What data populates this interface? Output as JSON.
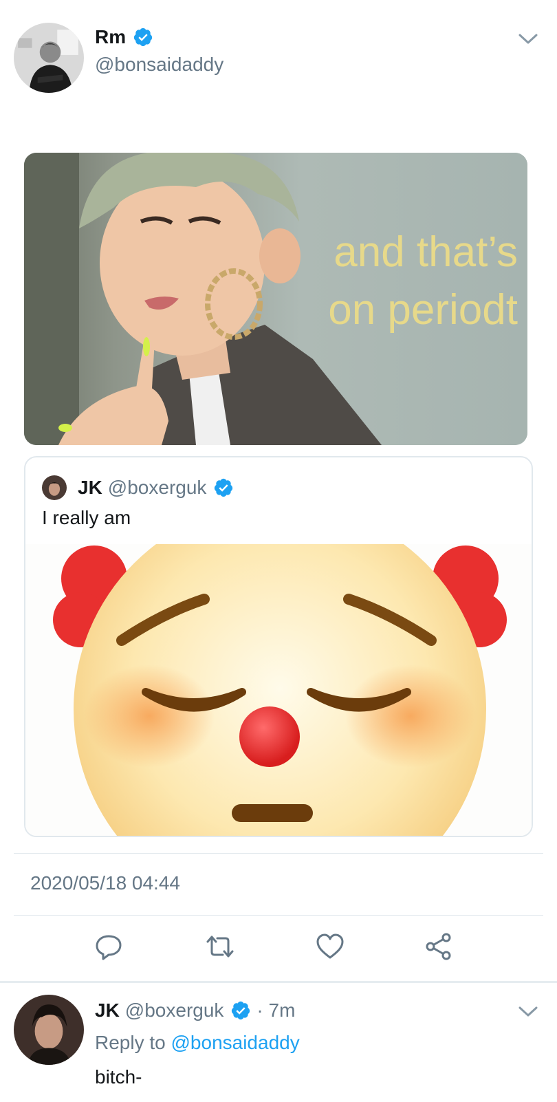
{
  "tweet": {
    "author_name": "Rm",
    "author_handle": "@bonsaidaddy",
    "verified": true,
    "media_caption": "and that’s on periodt",
    "timestamp": "2020/05/18 04:44"
  },
  "quote": {
    "author_name": "JK",
    "author_handle": "@boxerguk",
    "verified": true,
    "text": "I really am"
  },
  "actions": [
    {
      "icon": "reply-icon"
    },
    {
      "icon": "retweet-icon"
    },
    {
      "icon": "like-icon"
    },
    {
      "icon": "share-icon"
    }
  ],
  "reply": {
    "author_name": "JK",
    "author_handle": "@boxerguk",
    "verified": true,
    "time": "· 7m",
    "reply_prefix": "Reply to",
    "reply_target": "@bonsaidaddy",
    "text": "bitch-"
  },
  "colors": {
    "accent": "#1da1f2",
    "secondary_text": "#657786",
    "primary_text": "#14171a",
    "divider": "#e1e8ed",
    "caption": "#e7d98a"
  }
}
